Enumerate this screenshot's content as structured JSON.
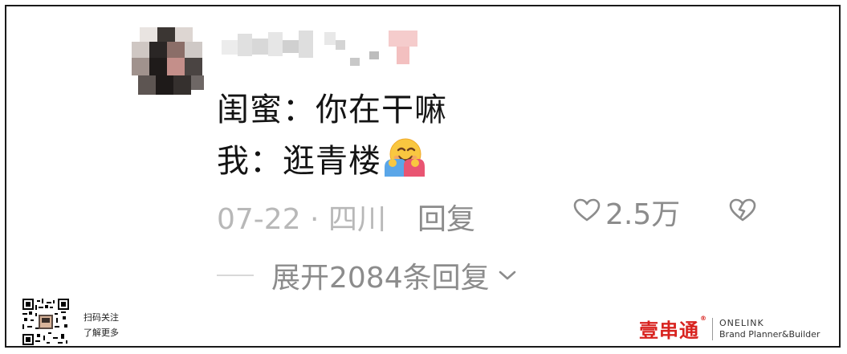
{
  "comment": {
    "line1": "闺蜜：你在干嘛",
    "line2": "我：逛青楼",
    "emoji": "hugging-face-emoji",
    "date_location": "07-22 · 四川",
    "reply_label": "回复",
    "like_count": "2.5万",
    "expand_label": "展开2084条回复"
  },
  "footer": {
    "qr_line1": "扫码关注",
    "qr_line2": "了解更多",
    "brand_logo": "壹串通",
    "brand_line1": "ONELINK",
    "brand_line2": "Brand Planner&Builder"
  },
  "colors": {
    "text_primary": "#141414",
    "text_secondary": "#8c8c8c",
    "text_muted": "#b8b8b8",
    "brand_red": "#d8231f"
  }
}
